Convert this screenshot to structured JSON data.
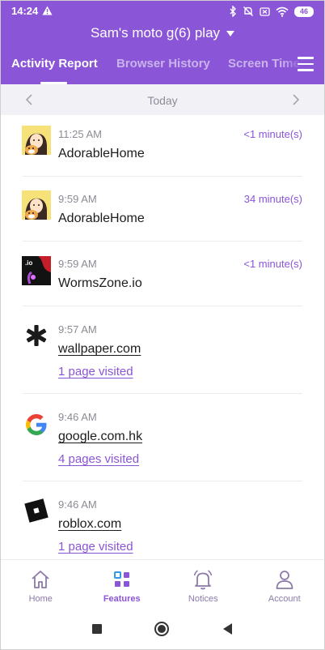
{
  "status_bar": {
    "time": "14:24",
    "battery": "46"
  },
  "header": {
    "device_name": "Sam's moto g(6) play",
    "tabs": [
      {
        "label": "Activity Report",
        "active": true
      },
      {
        "label": "Browser History",
        "active": false
      },
      {
        "label": "Screen Time",
        "active": false
      }
    ]
  },
  "date_bar": {
    "label": "Today"
  },
  "activities": [
    {
      "time": "11:25 AM",
      "title": "AdorableHome",
      "duration": "<1 minute(s)",
      "icon": "adorablehome-app-icon"
    },
    {
      "time": "9:59 AM",
      "title": "AdorableHome",
      "duration": "34 minute(s)",
      "icon": "adorablehome-app-icon"
    },
    {
      "time": "9:59 AM",
      "title": "WormsZone.io",
      "duration": "<1 minute(s)",
      "icon": "wormszone-app-icon"
    },
    {
      "time": "9:57 AM",
      "title": "wallpaper.com",
      "pages": "1 page visited",
      "icon": "asterisk-site-icon"
    },
    {
      "time": "9:46 AM",
      "title": "google.com.hk",
      "pages": "4 pages visited",
      "icon": "google-g-icon"
    },
    {
      "time": "9:46 AM",
      "title": "roblox.com",
      "pages": "1 page visited",
      "icon": "roblox-icon"
    }
  ],
  "bottom_nav": [
    {
      "label": "Home",
      "icon": "home-icon",
      "active": false
    },
    {
      "label": "Features",
      "icon": "features-grid-icon",
      "active": true
    },
    {
      "label": "Notices",
      "icon": "bell-icon",
      "active": false
    },
    {
      "label": "Account",
      "icon": "person-icon",
      "active": false
    }
  ],
  "colors": {
    "brand": "#8a55d6",
    "date_bar_bg": "#f1f1f6",
    "inactive_nav": "#8c7aa8"
  }
}
